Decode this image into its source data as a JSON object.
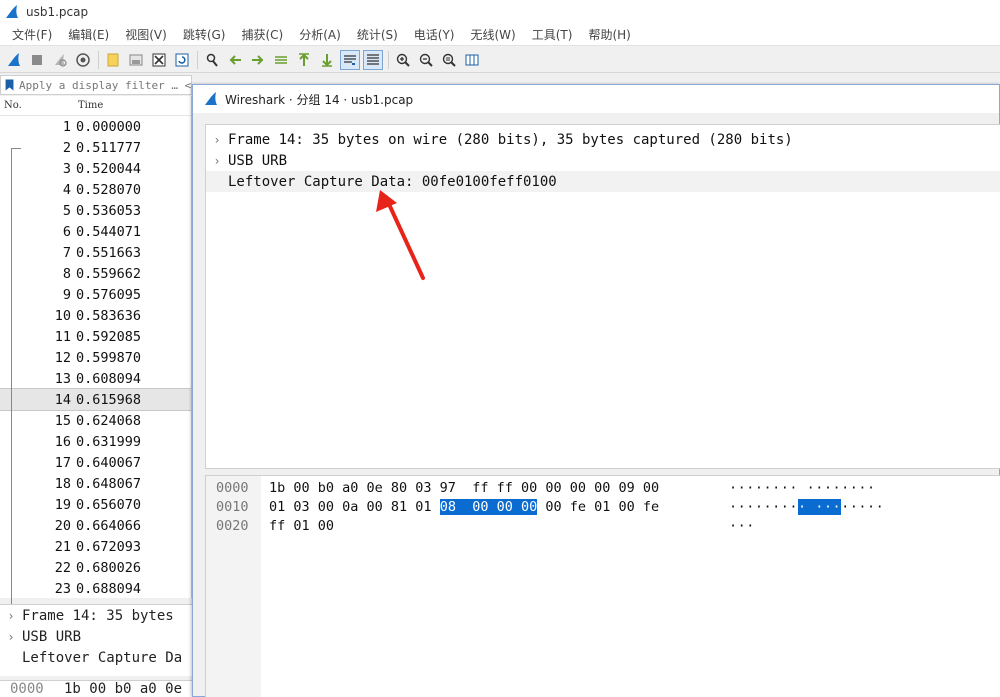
{
  "app": {
    "window_title": "usb1.pcap",
    "accent_color": "#1a73c8"
  },
  "menu": [
    "文件(F)",
    "编辑(E)",
    "视图(V)",
    "跳转(G)",
    "捕获(C)",
    "分析(A)",
    "统计(S)",
    "电话(Y)",
    "无线(W)",
    "工具(T)",
    "帮助(H)"
  ],
  "toolbar": {
    "icons": [
      "shark-fin-start-icon",
      "stop-square-icon",
      "restart-icon",
      "capture-options-icon",
      "open-file-icon",
      "save-file-icon",
      "close-file-icon",
      "reload-file-icon",
      "find-packet-icon",
      "go-back-icon",
      "go-forward-icon",
      "go-to-packet-icon",
      "go-first-icon",
      "go-last-icon",
      "auto-scroll-icon",
      "colorize-icon",
      "zoom-in-icon",
      "zoom-out-icon",
      "zoom-normal-icon",
      "resize-columns-icon"
    ]
  },
  "filter": {
    "placeholder": "Apply a display filter … <Ctrl-/>"
  },
  "packet_list": {
    "col_no": "No.",
    "col_time": "Time",
    "selected_no": "14",
    "rows": [
      {
        "no": "1",
        "time": "0.000000"
      },
      {
        "no": "2",
        "time": "0.511777"
      },
      {
        "no": "3",
        "time": "0.520044"
      },
      {
        "no": "4",
        "time": "0.528070"
      },
      {
        "no": "5",
        "time": "0.536053"
      },
      {
        "no": "6",
        "time": "0.544071"
      },
      {
        "no": "7",
        "time": "0.551663"
      },
      {
        "no": "8",
        "time": "0.559662"
      },
      {
        "no": "9",
        "time": "0.576095"
      },
      {
        "no": "10",
        "time": "0.583636"
      },
      {
        "no": "11",
        "time": "0.592085"
      },
      {
        "no": "12",
        "time": "0.599870"
      },
      {
        "no": "13",
        "time": "0.608094"
      },
      {
        "no": "14",
        "time": "0.615968"
      },
      {
        "no": "15",
        "time": "0.624068"
      },
      {
        "no": "16",
        "time": "0.631999"
      },
      {
        "no": "17",
        "time": "0.640067"
      },
      {
        "no": "18",
        "time": "0.648067"
      },
      {
        "no": "19",
        "time": "0.656070"
      },
      {
        "no": "20",
        "time": "0.664066"
      },
      {
        "no": "21",
        "time": "0.672093"
      },
      {
        "no": "22",
        "time": "0.680026"
      },
      {
        "no": "23",
        "time": "0.688094"
      }
    ]
  },
  "bg_detail": {
    "rows": [
      "Frame 14: 35 bytes",
      "USB URB",
      "Leftover Capture Da"
    ]
  },
  "bg_bytes": {
    "offset": "0000",
    "hex": "1b 00 b0 a0 0e"
  },
  "dialog": {
    "title": "Wireshark · 分组 14 · usb1.pcap",
    "tree": [
      {
        "expander": "›",
        "text": "Frame 14: 35 bytes on wire (280 bits), 35 bytes captured (280 bits)"
      },
      {
        "expander": "›",
        "text": "USB URB"
      },
      {
        "expander": "",
        "text": "Leftover Capture Data: 00fe0100feff0100"
      }
    ],
    "bytes": [
      {
        "offset": "0000",
        "hex_pre": "1b 00 b0 a0 0e 80 03 97  ff ff 00 00 00 00 09 00",
        "hex_sel": "",
        "hex_post": "",
        "ascii_pre": "········ ········",
        "ascii_sel": "",
        "ascii_post": ""
      },
      {
        "offset": "0010",
        "hex_pre": "01 03 00 0a 00 81 01 ",
        "hex_sel": "08  00 00 00",
        "hex_post": " 00 fe 01 00 fe",
        "ascii_pre": "········",
        "ascii_sel": "· ···",
        "ascii_post": "·····"
      },
      {
        "offset": "0020",
        "hex_pre": "ff 01 00",
        "hex_sel": "",
        "hex_post": "",
        "ascii_pre": "···",
        "ascii_sel": "",
        "ascii_post": ""
      }
    ]
  },
  "annotation": {
    "arrow_color": "#e8231a"
  }
}
